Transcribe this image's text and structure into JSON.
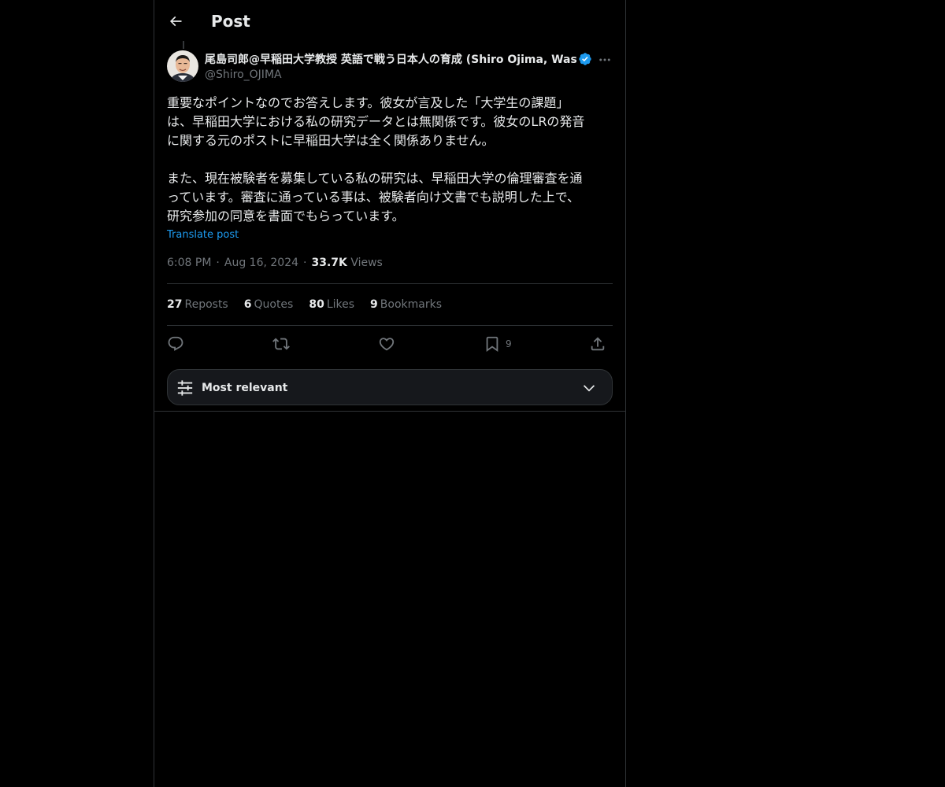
{
  "header": {
    "title": "Post",
    "back_icon": "arrow-left-icon"
  },
  "author": {
    "display_name": "尾島司郎@早稲田大学教授 英語で戦う日本人の育成 (Shiro Ojima, Waseda University)",
    "handle": "@Shiro_OJIMA",
    "verified": true,
    "verified_color": "#1d9bf0",
    "avatar_icon": "avatar-photo"
  },
  "post": {
    "paragraphs": [
      "重要なポイントなのでお答えします。彼女が言及した「大学生の課題」\nは、早稲田大学における私の研究データとは無関係です。彼女のLRの発音\nに関する元のポストに早稲田大学は全く関係ありません。",
      "また、現在被験者を募集している私の研究は、早稲田大学の倫理審査を通\nっています。審査に通っている事は、被験者向け文書でも説明した上で、\n研究参加の同意を書面でもらっています。"
    ],
    "translate_label": "Translate post",
    "time": "6:08 PM",
    "date": "Aug 16, 2024",
    "views_count": "33.7K",
    "views_label": "Views",
    "dot": "·"
  },
  "stats": [
    {
      "count": "27",
      "label": "Reposts"
    },
    {
      "count": "6",
      "label": "Quotes"
    },
    {
      "count": "80",
      "label": "Likes"
    },
    {
      "count": "9",
      "label": "Bookmarks"
    }
  ],
  "actions": {
    "reply_icon": "reply-icon",
    "repost_icon": "repost-icon",
    "like_icon": "heart-icon",
    "bookmark_icon": "bookmark-icon",
    "bookmark_count": "9",
    "share_icon": "share-icon"
  },
  "sort": {
    "label": "Most relevant",
    "icon": "sliders-icon",
    "chevron": "chevron-down-icon"
  },
  "colors": {
    "background": "#000000",
    "text": "#e7e9ea",
    "muted": "#71767b",
    "link": "#1d9bf0",
    "border": "#2f3336"
  }
}
